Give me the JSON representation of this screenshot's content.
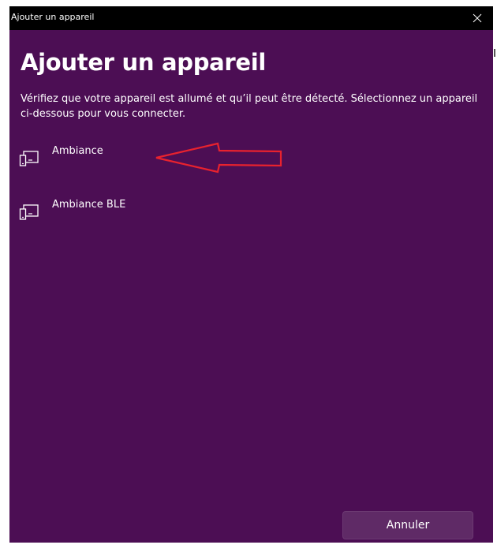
{
  "window": {
    "title": "Ajouter un appareil",
    "background": "#4c0e54",
    "titlebar_background": "#000000"
  },
  "header": {
    "title": "Ajouter un appareil",
    "instructions": "Vérifiez que votre appareil est allumé et qu’il peut être détecté. Sélectionnez un appareil ci-dessous pour vous connecter."
  },
  "devices": [
    {
      "label": "Ambiance",
      "icon": "device-icon"
    },
    {
      "label": "Ambiance BLE",
      "icon": "device-icon"
    }
  ],
  "annotation": {
    "type": "arrow",
    "color": "#e8222e",
    "points_to": "Ambiance"
  },
  "footer": {
    "cancel_label": "Annuler"
  }
}
